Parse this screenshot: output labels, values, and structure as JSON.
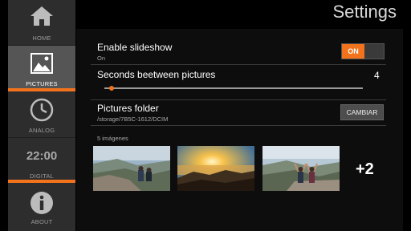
{
  "header": {
    "title": "Settings"
  },
  "sidebar": {
    "items": [
      {
        "label": "HOME",
        "icon": "home-icon"
      },
      {
        "label": "PICTURES",
        "icon": "pictures-icon",
        "active": true
      },
      {
        "label": "ANALOG",
        "icon": "analog-clock-icon"
      },
      {
        "label": "DIGITAL",
        "icon": "digital-clock-icon",
        "display": "22:00"
      },
      {
        "label": "ABOUT",
        "icon": "info-icon"
      }
    ],
    "accent": "#f2731c"
  },
  "slideshow": {
    "title": "Enable slideshow",
    "subtitle": "On",
    "toggle_label": "ON",
    "enabled": true
  },
  "interval": {
    "title": "Seconds beetween pictures",
    "value": "4",
    "level": 0.02
  },
  "folder": {
    "title": "Pictures folder",
    "path": "/storage/7B5C-1612/DCIM",
    "button_label": "CAMBIAR"
  },
  "gallery": {
    "count_label": "5 imágenes",
    "thumbnails": [
      {
        "description": "two people sitting on a cliff above a valley"
      },
      {
        "description": "sunset over mountain peaks and clouds"
      },
      {
        "description": "two people cheering on a cliff edge"
      }
    ],
    "more_label": "+2"
  }
}
